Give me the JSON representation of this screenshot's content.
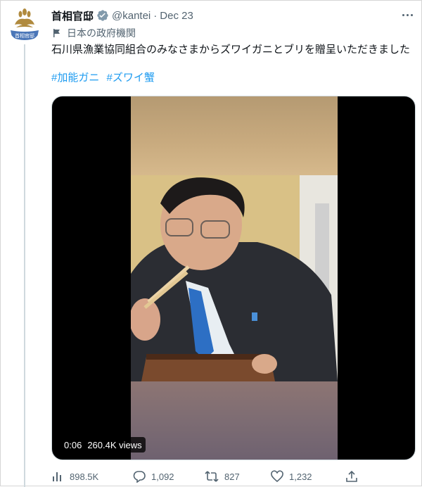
{
  "tweet": {
    "display_name": "首相官邸",
    "handle": "@kantei",
    "separator": "·",
    "date": "Dec 23",
    "affiliation_label": "日本の政府機関",
    "text": "石川県漁業協同組合のみなさまからズワイガニとブリを贈呈いただきました",
    "hashtags": [
      "#加能ガニ",
      "#ズワイ蟹"
    ],
    "avatar_text": "首相官邸"
  },
  "video": {
    "time": "0:06",
    "views": "260.4K views"
  },
  "stats": {
    "views": "898.5K",
    "replies": "1,092",
    "retweets": "827",
    "likes": "1,232"
  },
  "colors": {
    "accent": "#1d9bf0",
    "secondary_text": "#536471",
    "verified_badge": "#829aab"
  },
  "icons": [
    "kantei-seal-icon",
    "verified-badge-icon",
    "more-options-icon",
    "flag-icon",
    "views-icon",
    "reply-icon",
    "retweet-icon",
    "like-icon",
    "share-icon"
  ]
}
